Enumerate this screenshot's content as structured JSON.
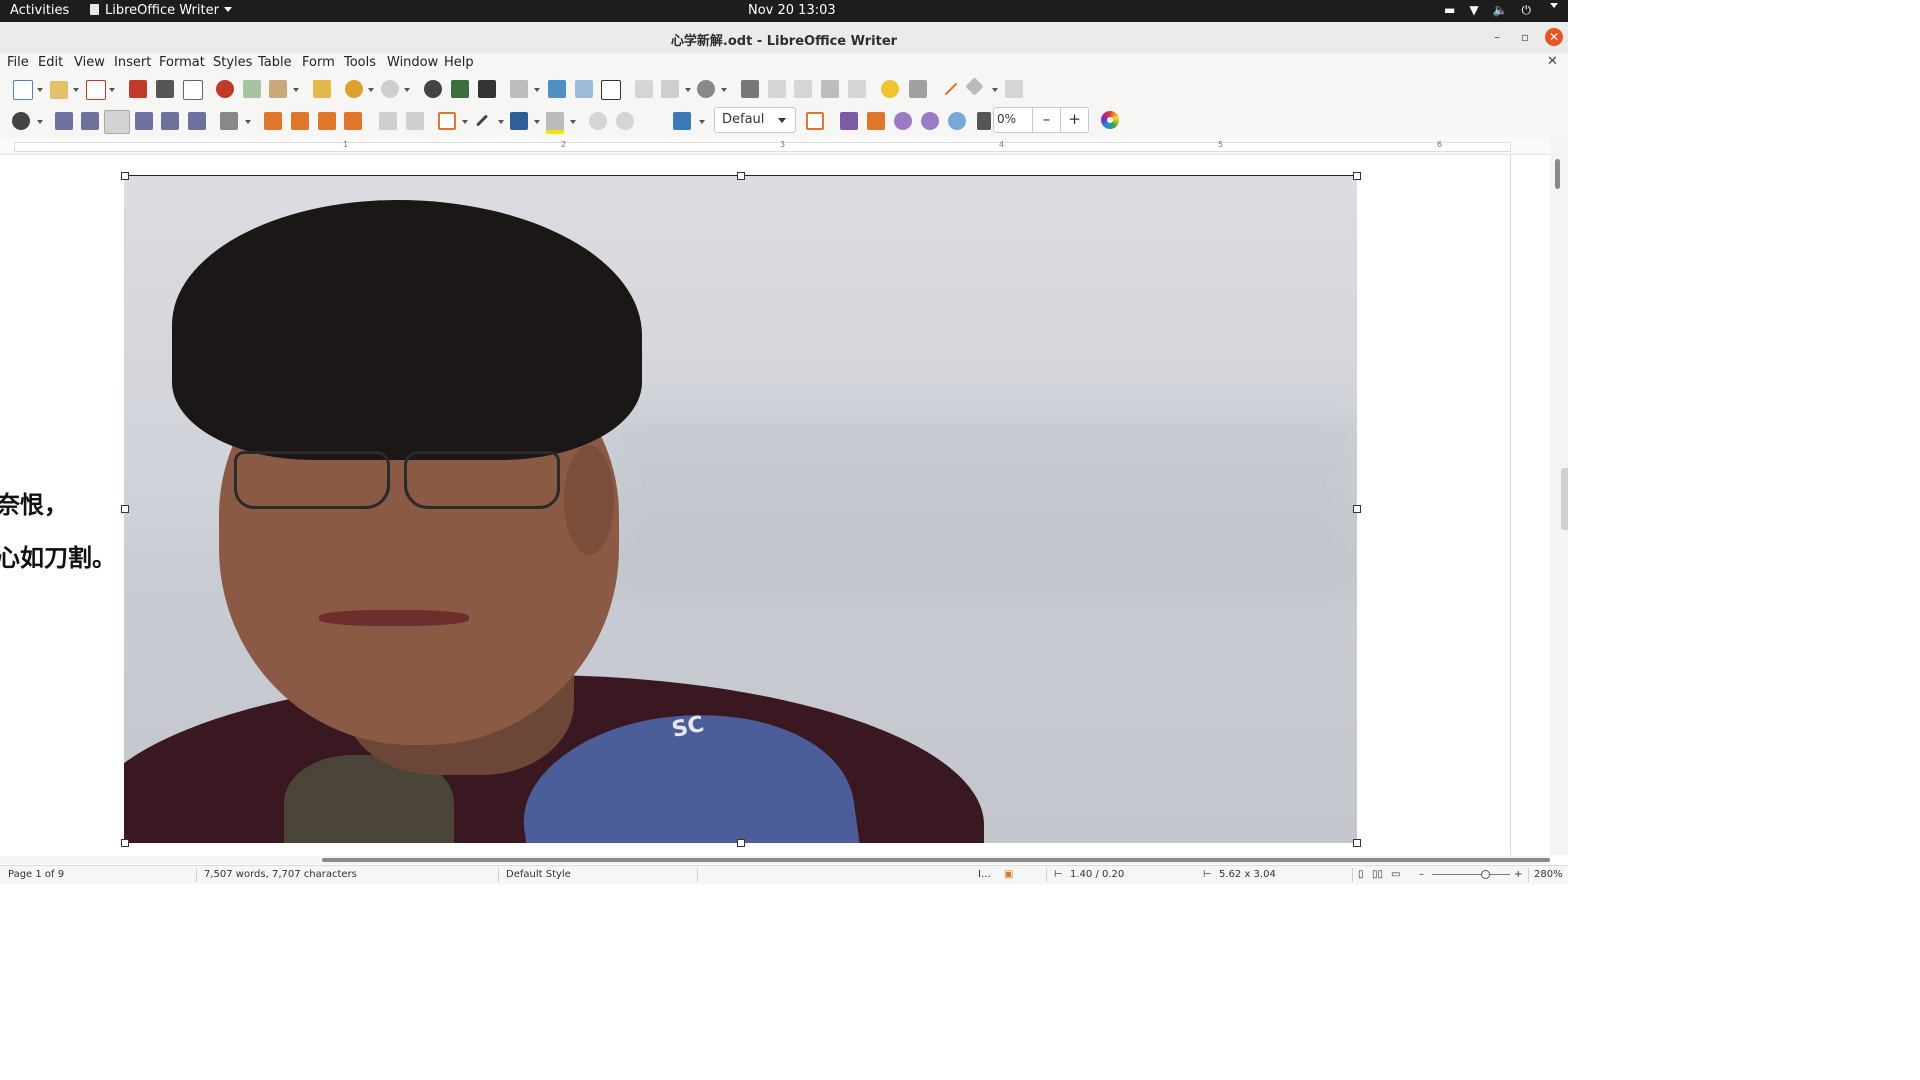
{
  "topbar": {
    "activities": "Activities",
    "app_name": "LibreOffice Writer",
    "clock": "Nov 20  13:03",
    "tray_icons": [
      "keyboard-icon",
      "wifi-icon",
      "volume-icon",
      "power-icon"
    ]
  },
  "window": {
    "title": "心学新解.odt - LibreOffice Writer",
    "min_glyph": "–",
    "max_glyph": "▫",
    "close_glyph": "✕"
  },
  "menubar": {
    "items": [
      "File",
      "Edit",
      "View",
      "Insert",
      "Format",
      "Styles",
      "Table",
      "Form",
      "Tools",
      "Window",
      "Help"
    ],
    "close_doc": "✕"
  },
  "toolbar2": {
    "frame_style_value": "Defaul",
    "transparency_value": "0%",
    "minus": "–",
    "plus": "+"
  },
  "ruler": {
    "numbers": [
      "1",
      "2",
      "3",
      "4",
      "5",
      "6"
    ]
  },
  "document": {
    "line1": "奈恨，",
    "line2": "心如刀割。",
    "photo_logo_text": "SC"
  },
  "statusbar": {
    "page": "Page 1 of 9",
    "words": "7,507 words, 7,707 characters",
    "page_style": "Default Style",
    "position": "1.40 / 0.20",
    "size": "5.62 x 3.04",
    "zoom": "280%",
    "zoom_minus": "–",
    "zoom_plus": "+",
    "zoom_level_percent": 280
  },
  "colors": {
    "topbar_bg": "#1d1d1d",
    "close_button": "#e95420",
    "ui_bg": "#f6f6f5"
  }
}
